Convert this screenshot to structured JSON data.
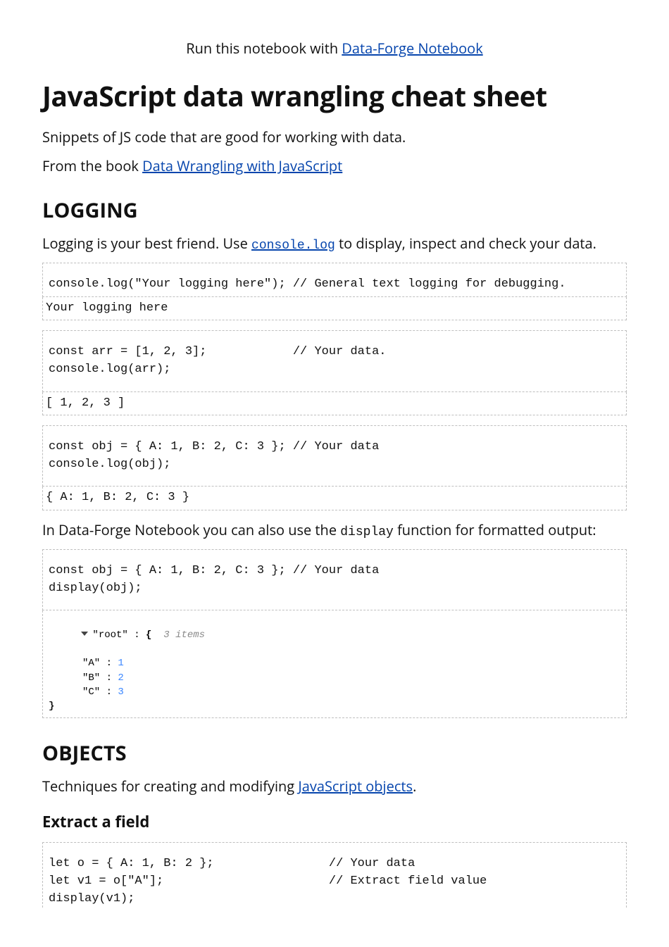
{
  "run": {
    "prefix": "Run this notebook with ",
    "link": "Data-Forge Notebook"
  },
  "title": "JavaScript data wrangling cheat sheet",
  "intro": "Snippets of JS code that are good for working with data.",
  "from": {
    "prefix": "From the book ",
    "link": "Data Wrangling with JavaScript"
  },
  "section_logging": "LOGGING",
  "logging_sentence": {
    "pre": "Logging is your best friend. Use ",
    "link": "console.log",
    "post": " to display, inspect and check your data."
  },
  "cell1": {
    "code": "console.log(\"Your logging here\"); // General text logging for debugging.",
    "out": "Your logging here"
  },
  "cell2": {
    "code_l1": "const arr = [1, 2, 3];            // Your data.",
    "code_l2": "console.log(arr);",
    "out": "[ 1, 2, 3 ]"
  },
  "cell3": {
    "code_l1": "const obj = { A: 1, B: 2, C: 3 }; // Your data",
    "code_l2": "console.log(obj);",
    "out": "{ A: 1, B: 2, C: 3 }"
  },
  "display_sentence": {
    "pre": "In Data-Forge Notebook you can also use the ",
    "code": "display",
    "post": " function for formatted output:"
  },
  "cell4": {
    "code_l1": "const obj = { A: 1, B: 2, C: 3 }; // Your data",
    "code_l2": "",
    "code_l3": "display(obj);",
    "tree": {
      "root_label": "\"root\" : ",
      "open": "{",
      "items": "3 items",
      "rows": [
        {
          "k": "\"A\" : ",
          "v": "1"
        },
        {
          "k": "\"B\" : ",
          "v": "2"
        },
        {
          "k": "\"C\" : ",
          "v": "3"
        }
      ],
      "close": "}"
    }
  },
  "section_objects": "OBJECTS",
  "objects_sentence": {
    "pre": "Techniques for creating and modifying ",
    "link": "JavaScript objects",
    "post": "."
  },
  "subsection_extract": "Extract a field",
  "cell5": {
    "code_l1": "let o = { A: 1, B: 2 };                // Your data",
    "code_l2": "let v1 = o[\"A\"];                       // Extract field value",
    "code_l3": "display(v1);"
  }
}
